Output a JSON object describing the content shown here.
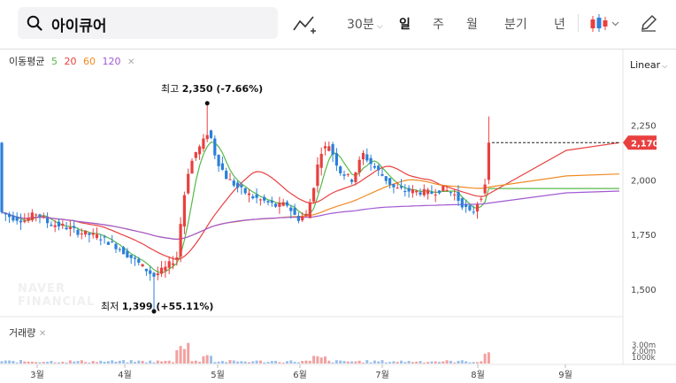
{
  "search": {
    "value": "아이큐어",
    "icon": "search-icon"
  },
  "toolbar": {
    "interval": "30분",
    "periods": [
      "일",
      "주",
      "월",
      "분기",
      "년"
    ],
    "active_period": "일"
  },
  "ma": {
    "label": "이동평균",
    "periods": [
      "5",
      "20",
      "60",
      "120"
    ],
    "colors": [
      "#57b84a",
      "#e8403f",
      "#f08a24",
      "#a05ad2"
    ]
  },
  "scale_mode": "Linear",
  "volume_label": "거래량",
  "colors": {
    "up": "#e8403f",
    "down": "#2b7fd9",
    "price_tag": "#e8403f"
  },
  "chart_data": {
    "type": "candlestick",
    "y_ticks": [
      "2,250",
      "2,000",
      "1,750",
      "1,500"
    ],
    "y_tick_values": [
      2250,
      2000,
      1750,
      1500
    ],
    "ylim": [
      1375,
      2450
    ],
    "x_ticks": [
      "3월",
      "4월",
      "5월",
      "6월",
      "7월",
      "8월",
      "9월"
    ],
    "current_price": "2,170",
    "high_annotation": {
      "label": "최고",
      "value": "2,350 (-7.66%)",
      "price": 2350
    },
    "low_annotation": {
      "label": "최저",
      "value": "1,399 (+55.11%)",
      "price": 1399
    },
    "volume_ticks": [
      "3.00m",
      "2.00m",
      "1000k"
    ],
    "watermark": [
      "NAVER",
      "FINANCIAL"
    ]
  }
}
